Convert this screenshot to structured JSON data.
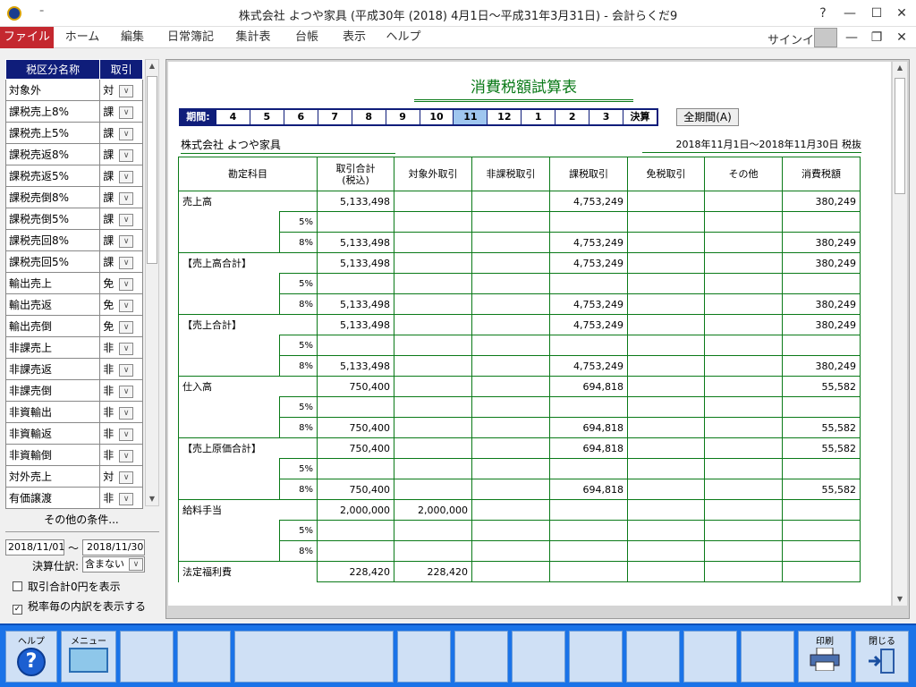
{
  "window": {
    "title": "株式会社 よつや家具 (平成30年 (2018) 4月1日～平成31年3月31日) - 会計らくだ9",
    "qa_glyph": "₌",
    "help": "?",
    "minimize": "—",
    "maximize": "☐",
    "close": "✕"
  },
  "ribbon": {
    "tabs": [
      "ファイル",
      "ホーム",
      "編集",
      "日常簿記",
      "集計表",
      "台帳",
      "表示",
      "ヘルプ"
    ],
    "signin": "サインイン",
    "min2": "—",
    "restore2": "❐",
    "close2": "✕"
  },
  "categories": {
    "header_name": "税区分名称",
    "header_type": "取引",
    "items": [
      {
        "name": "対象外",
        "type": "対"
      },
      {
        "name": "課税売上8%",
        "type": "課"
      },
      {
        "name": "課税売上5%",
        "type": "課"
      },
      {
        "name": "課税売返8%",
        "type": "課"
      },
      {
        "name": "課税売返5%",
        "type": "課"
      },
      {
        "name": "課税売倒8%",
        "type": "課"
      },
      {
        "name": "課税売倒5%",
        "type": "課"
      },
      {
        "name": "課税売回8%",
        "type": "課"
      },
      {
        "name": "課税売回5%",
        "type": "課"
      },
      {
        "name": "輸出売上",
        "type": "免"
      },
      {
        "name": "輸出売返",
        "type": "免"
      },
      {
        "name": "輸出売倒",
        "type": "免"
      },
      {
        "name": "非課売上",
        "type": "非"
      },
      {
        "name": "非課売返",
        "type": "非"
      },
      {
        "name": "非課売倒",
        "type": "非"
      },
      {
        "name": "非資輸出",
        "type": "非"
      },
      {
        "name": "非資輸返",
        "type": "非"
      },
      {
        "name": "非資輸倒",
        "type": "非"
      },
      {
        "name": "対外売上",
        "type": "対"
      },
      {
        "name": "有価譲渡",
        "type": "非"
      }
    ]
  },
  "filters": {
    "other_conditions": "その他の条件...",
    "date_from": "2018/11/01",
    "tilde": "～",
    "date_to": "2018/11/30",
    "kessan_label": "決算仕訳:",
    "kessan_value": "含まない",
    "check_zero": "取引合計0円を表示",
    "check_zero_checked": false,
    "check_rate": "税率毎の内訳を表示する",
    "check_rate_checked": true
  },
  "report": {
    "title": "消費税額試算表",
    "period_label": "期間:",
    "periods": [
      "4",
      "5",
      "6",
      "7",
      "8",
      "9",
      "10",
      "11",
      "12",
      "1",
      "2",
      "3",
      "決算"
    ],
    "selected_period": "11",
    "all_period_button": "全期間(A)",
    "company": "株式会社 よつや家具",
    "period_text": "2018年11月1日～2018年11月30日 税抜",
    "columns": [
      "勘定科目",
      "取引合計\n(税込)",
      "対象外取引",
      "非課税取引",
      "課税取引",
      "免税取引",
      "その他",
      "消費税額"
    ],
    "groups": [
      {
        "account": "売上高",
        "rows": [
          {
            "rate": "",
            "total": "5,133,498",
            "taigai": "",
            "hikazei": "",
            "kazei": "4,753,249",
            "menzei": "",
            "sonota": "",
            "tax": "380,249"
          },
          {
            "rate": "5%",
            "total": "",
            "taigai": "",
            "hikazei": "",
            "kazei": "",
            "menzei": "",
            "sonota": "",
            "tax": ""
          },
          {
            "rate": "8%",
            "total": "5,133,498",
            "taigai": "",
            "hikazei": "",
            "kazei": "4,753,249",
            "menzei": "",
            "sonota": "",
            "tax": "380,249"
          }
        ]
      },
      {
        "account": "【売上高合計】",
        "rows": [
          {
            "rate": "",
            "total": "5,133,498",
            "taigai": "",
            "hikazei": "",
            "kazei": "4,753,249",
            "menzei": "",
            "sonota": "",
            "tax": "380,249"
          },
          {
            "rate": "5%",
            "total": "",
            "taigai": "",
            "hikazei": "",
            "kazei": "",
            "menzei": "",
            "sonota": "",
            "tax": ""
          },
          {
            "rate": "8%",
            "total": "5,133,498",
            "taigai": "",
            "hikazei": "",
            "kazei": "4,753,249",
            "menzei": "",
            "sonota": "",
            "tax": "380,249"
          }
        ]
      },
      {
        "account": "【売上合計】",
        "rows": [
          {
            "rate": "",
            "total": "5,133,498",
            "taigai": "",
            "hikazei": "",
            "kazei": "4,753,249",
            "menzei": "",
            "sonota": "",
            "tax": "380,249"
          },
          {
            "rate": "5%",
            "total": "",
            "taigai": "",
            "hikazei": "",
            "kazei": "",
            "menzei": "",
            "sonota": "",
            "tax": ""
          },
          {
            "rate": "8%",
            "total": "5,133,498",
            "taigai": "",
            "hikazei": "",
            "kazei": "4,753,249",
            "menzei": "",
            "sonota": "",
            "tax": "380,249"
          }
        ]
      },
      {
        "account": "仕入高",
        "rows": [
          {
            "rate": "",
            "total": "750,400",
            "taigai": "",
            "hikazei": "",
            "kazei": "694,818",
            "menzei": "",
            "sonota": "",
            "tax": "55,582"
          },
          {
            "rate": "5%",
            "total": "",
            "taigai": "",
            "hikazei": "",
            "kazei": "",
            "menzei": "",
            "sonota": "",
            "tax": ""
          },
          {
            "rate": "8%",
            "total": "750,400",
            "taigai": "",
            "hikazei": "",
            "kazei": "694,818",
            "menzei": "",
            "sonota": "",
            "tax": "55,582"
          }
        ]
      },
      {
        "account": "【売上原価合計】",
        "rows": [
          {
            "rate": "",
            "total": "750,400",
            "taigai": "",
            "hikazei": "",
            "kazei": "694,818",
            "menzei": "",
            "sonota": "",
            "tax": "55,582"
          },
          {
            "rate": "5%",
            "total": "",
            "taigai": "",
            "hikazei": "",
            "kazei": "",
            "menzei": "",
            "sonota": "",
            "tax": ""
          },
          {
            "rate": "8%",
            "total": "750,400",
            "taigai": "",
            "hikazei": "",
            "kazei": "694,818",
            "menzei": "",
            "sonota": "",
            "tax": "55,582"
          }
        ]
      },
      {
        "account": "給料手当",
        "rows": [
          {
            "rate": "",
            "total": "2,000,000",
            "taigai": "2,000,000",
            "hikazei": "",
            "kazei": "",
            "menzei": "",
            "sonota": "",
            "tax": ""
          },
          {
            "rate": "5%",
            "total": "",
            "taigai": "",
            "hikazei": "",
            "kazei": "",
            "menzei": "",
            "sonota": "",
            "tax": ""
          },
          {
            "rate": "8%",
            "total": "",
            "taigai": "",
            "hikazei": "",
            "kazei": "",
            "menzei": "",
            "sonota": "",
            "tax": ""
          }
        ]
      },
      {
        "account": "法定福利費",
        "rows": [
          {
            "rate": "",
            "total": "228,420",
            "taigai": "228,420",
            "hikazei": "",
            "kazei": "",
            "menzei": "",
            "sonota": "",
            "tax": ""
          }
        ]
      }
    ]
  },
  "footer": {
    "help": "ヘルプ",
    "menu": "メニュー",
    "print": "印刷",
    "close": "閉じる",
    "help_glyph": "?"
  }
}
